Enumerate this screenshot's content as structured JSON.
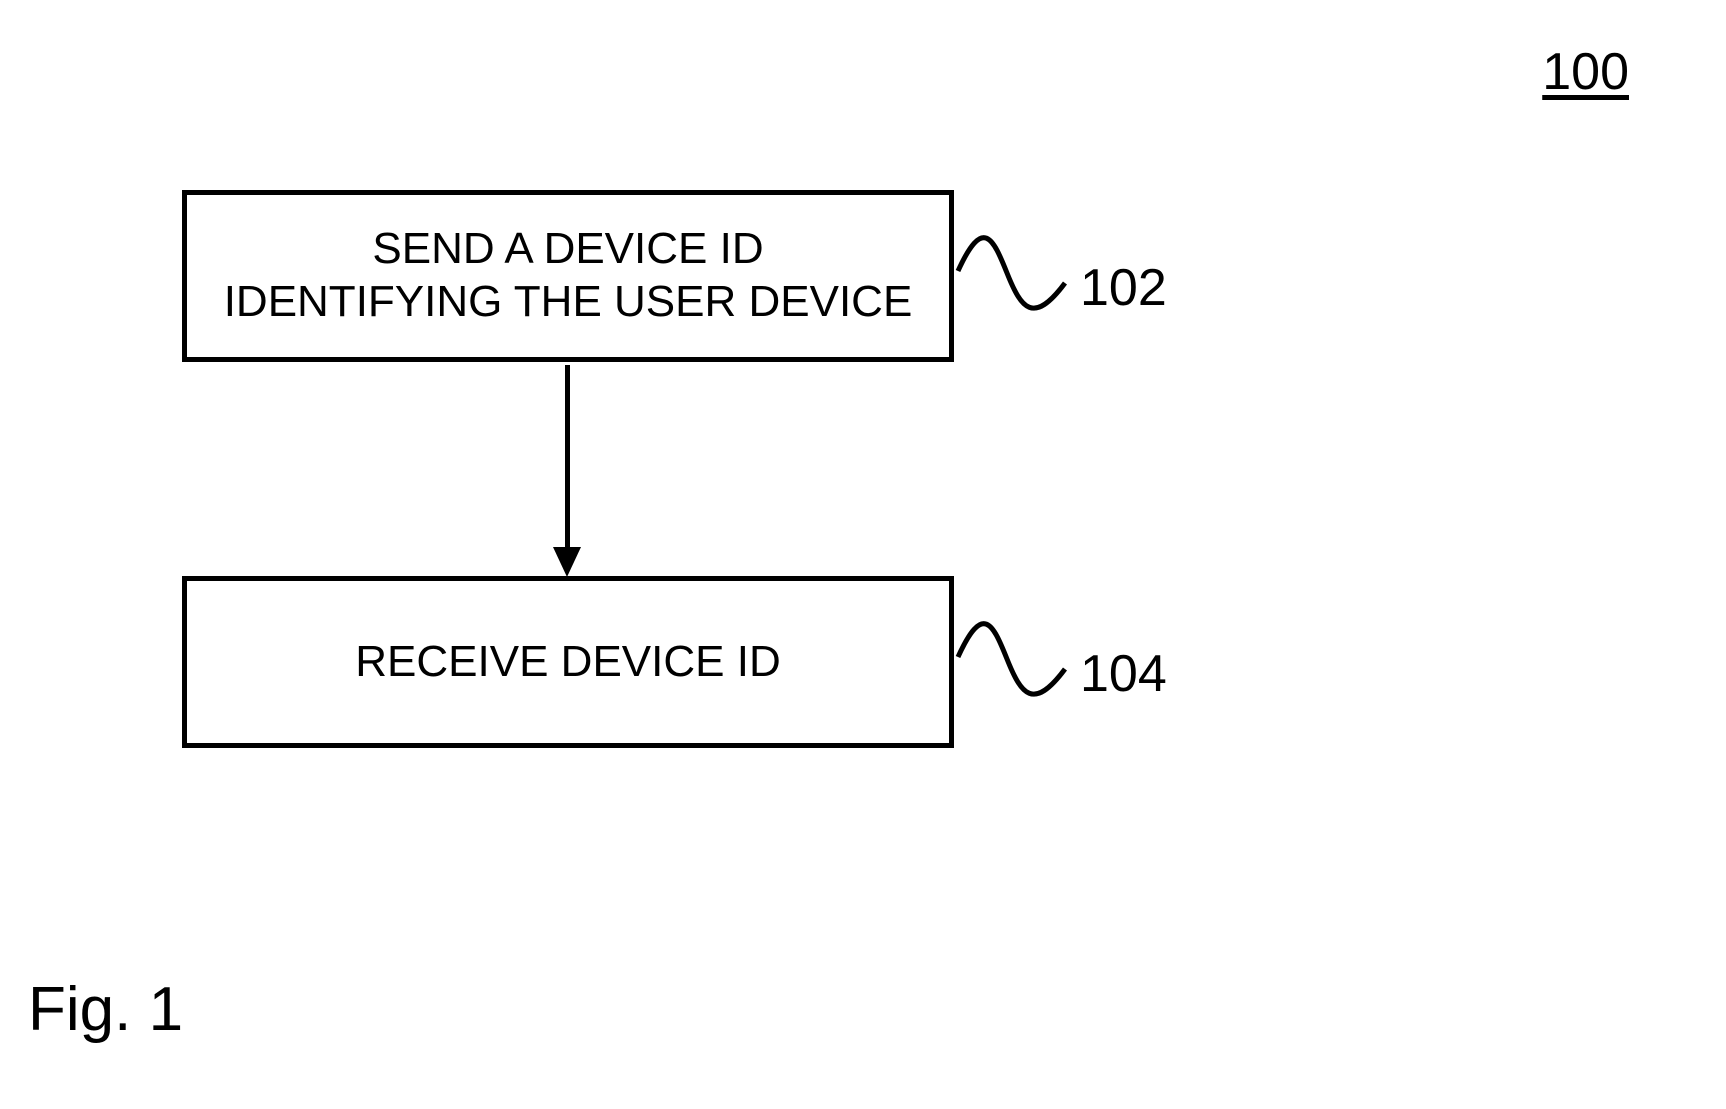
{
  "figure": {
    "number": "100",
    "caption": "Fig. 1"
  },
  "steps": {
    "step102": {
      "text": "SEND A DEVICE ID\nIDENTIFYING THE USER DEVICE",
      "ref": "102"
    },
    "step104": {
      "text": "RECEIVE DEVICE ID",
      "ref": "104"
    }
  }
}
